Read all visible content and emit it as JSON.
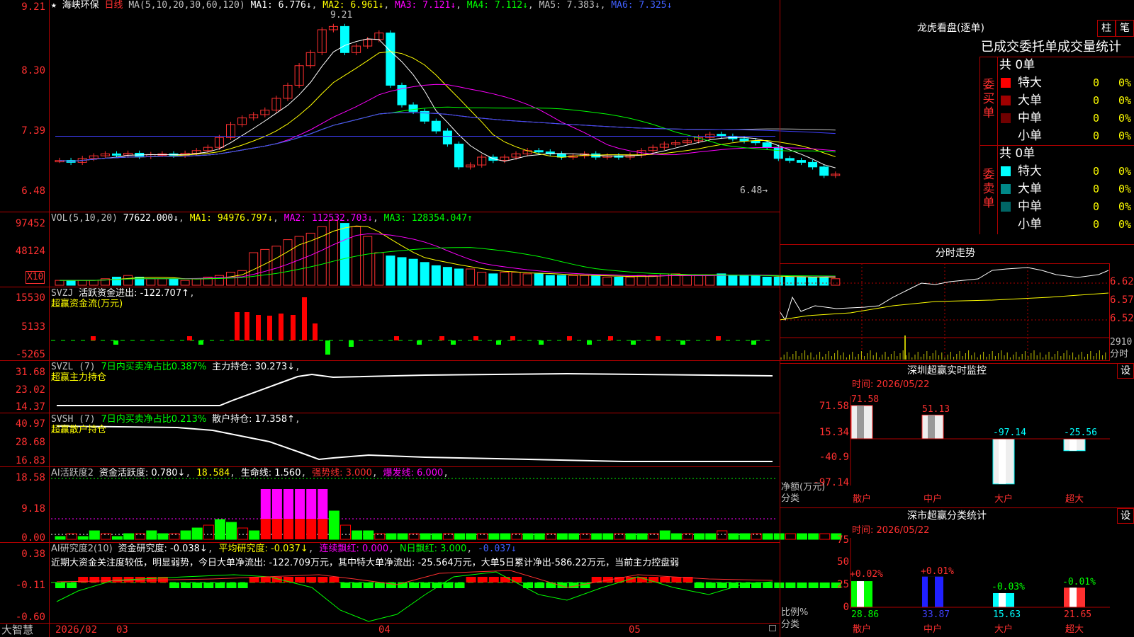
{
  "main_chart": {
    "star": "★",
    "stock_name": "海峡环保",
    "period": "日线",
    "ma_label": "MA(5,10,20,30,60,120)",
    "ma1": "MA1: 6.776↓",
    "ma2": "MA2: 6.961↓",
    "ma3": "MA3: 7.121↓",
    "ma4": "MA4: 7.112↓",
    "ma5": "MA5: 7.383↓",
    "ma6": "MA6: 7.325↓",
    "y_ticks": [
      "9.21",
      "8.30",
      "7.39",
      "6.48"
    ],
    "high_label": "9.21",
    "low_label": "6.48→",
    "colors": {
      "ma1": "#ffffff",
      "ma2": "#ffff00",
      "ma3": "#ff00ff",
      "ma4": "#00ff00",
      "ma5": "#c0c0c0",
      "ma6": "#4040ff",
      "up": "#ff3030",
      "down": "#00ffff"
    }
  },
  "vol_panel": {
    "label": "VOL(5,10,20)",
    "value": "77622.000↓",
    "ma1": "MA1: 94976.797↓",
    "ma2": "MA2: 112532.703↓",
    "ma3": "MA3: 128354.047↑",
    "y_ticks": [
      "97452",
      "48124"
    ],
    "unit": "X10"
  },
  "svzj_panel": {
    "label": "SVZJ",
    "value": "活跃资金进出: -122.707↑",
    "subtitle": "超赢资金流(万元)",
    "y_ticks": [
      "15530",
      "5133",
      "-5265"
    ]
  },
  "svzl_panel": {
    "label": "SVZL (7)",
    "ratio": "7日内买卖净占比0.387%",
    "hold": "主力持仓: 30.273↓",
    "subtitle": "超赢主力持仓",
    "y_ticks": [
      "31.68",
      "23.02",
      "14.37"
    ]
  },
  "svsh_panel": {
    "label": "SVSH (7)",
    "ratio": "7日内买卖净占比0.213%",
    "hold": "散户持仓: 17.358↑",
    "subtitle": "超赢散户持仓",
    "y_ticks": [
      "40.97",
      "28.68",
      "16.83"
    ]
  },
  "ai_active_panel": {
    "label": "AI活跃度2",
    "active": "资金活跃度: 0.780↓",
    "val2": "18.584",
    "life": "生命线: 1.560",
    "strong": "强势线: 3.000",
    "burst": "爆发线: 6.000",
    "y_ticks": [
      "18.58",
      "9.18",
      "0.00"
    ]
  },
  "ai_research_panel": {
    "label": "AI研究度2(10)",
    "research": "资金研究度: -0.038↓",
    "avg": "平均研究度: -0.037↓",
    "red1": "连续飘红: 0.000",
    "red2": "N日飘红: 3.000",
    "val": "-0.037↓",
    "comment": "近期大资金关注度较低，明显弱势，今日大单净流出: -122.709万元，其中特大单净流出: -25.564万元，大单5日累计净出-586.22万元，当前主力控盘弱",
    "y_ticks": [
      "0.38",
      "-0.11",
      "-0.60"
    ]
  },
  "bottom_bar": {
    "brand": "大智慧",
    "dates": [
      "2026/02",
      "03",
      "04",
      "05"
    ]
  },
  "dragon_tiger": {
    "title": "龙虎看盘(逐单)",
    "btn_bar": "柱",
    "btn_pen": "笔",
    "subtitle": "已成交委托单成交量统计",
    "buy_label": "委买单",
    "sell_label": "委卖单",
    "buy_total": "共 0单",
    "sell_total": "共 0单",
    "buy_rows": [
      {
        "name": "特大",
        "count": "0",
        "pct": "0%",
        "color": "#ff0000"
      },
      {
        "name": "大单",
        "count": "0",
        "pct": "0%",
        "color": "#a00000"
      },
      {
        "name": "中单",
        "count": "0",
        "pct": "0%",
        "color": "#700000"
      },
      {
        "name": "小单",
        "count": "0",
        "pct": "0%",
        "color": "#000000"
      }
    ],
    "sell_rows": [
      {
        "name": "特大",
        "count": "0",
        "pct": "0%",
        "color": "#00ffff"
      },
      {
        "name": "大单",
        "count": "0",
        "pct": "0%",
        "color": "#008888"
      },
      {
        "name": "中单",
        "count": "0",
        "pct": "0%",
        "color": "#006666"
      },
      {
        "name": "小单",
        "count": "0",
        "pct": "0%",
        "color": "#000000"
      }
    ]
  },
  "intraday": {
    "title": "分时走势",
    "y_ticks": [
      "6.62",
      "6.57",
      "6.52"
    ],
    "vol_tick": "2910",
    "vol_unit": "分时"
  },
  "realtime_monitor": {
    "title": "深圳超赢实时监控",
    "settings": "设",
    "time": "时间: 2026/05/22",
    "y_ticks": [
      "71.58",
      "15.34",
      "-40.9",
      "-97.14"
    ],
    "y_label": "净额(万元)",
    "x_label": "分类",
    "categories": [
      "散户",
      "中户",
      "大户",
      "超大"
    ],
    "values": [
      "71.58",
      "51.13",
      "-97.14",
      "-25.56"
    ],
    "chart_data": {
      "type": "bar",
      "categories": [
        "散户",
        "中户",
        "大户",
        "超大"
      ],
      "values": [
        71.58,
        51.13,
        -97.14,
        -25.56
      ],
      "ylabel": "净额(万元)",
      "ylim": [
        -97.14,
        71.58
      ]
    }
  },
  "class_stats": {
    "title": "深市超赢分类统计",
    "settings": "设",
    "time": "时间: 2026/05/22",
    "y_ticks": [
      "75",
      "50",
      "25",
      "0"
    ],
    "y_label": "比例%",
    "x_label": "分类",
    "categories": [
      "散户",
      "中户",
      "大户",
      "超大"
    ],
    "top_labels": [
      "+0.02%",
      "+0.01%",
      "-0.03%",
      "-0.01%"
    ],
    "bottom_values": [
      "28.86",
      "33.87",
      "15.63",
      "21.65"
    ],
    "chart_data": {
      "type": "bar",
      "categories": [
        "散户",
        "中户",
        "大户",
        "超大"
      ],
      "values": [
        28.86,
        33.87,
        15.63,
        21.65
      ],
      "ylabel": "比例%",
      "ylim": [
        0,
        75
      ]
    }
  }
}
